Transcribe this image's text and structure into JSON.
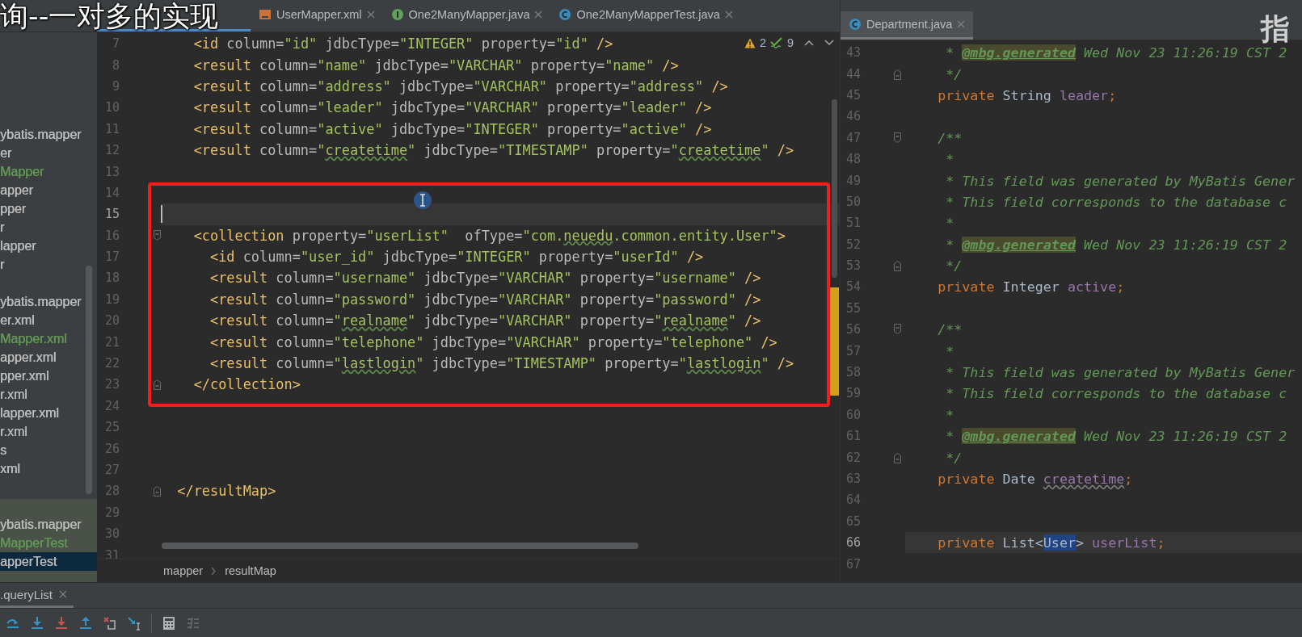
{
  "overlay_caption": "询--一对多的实现",
  "overlay_corner_text": "指",
  "sidebar": {
    "groups": [
      {
        "highlighted": false,
        "items": [
          {
            "label": "ybatis.mapper",
            "color": "#bbbbbb",
            "selected": false
          },
          {
            "label": "er",
            "color": "#bbbbbb",
            "selected": false
          },
          {
            "label": "Mapper",
            "color": "#629755",
            "selected": false
          },
          {
            "label": "apper",
            "color": "#bbbbbb",
            "selected": false
          },
          {
            "label": "pper",
            "color": "#bbbbbb",
            "selected": false
          },
          {
            "label": "r",
            "color": "#bbbbbb",
            "selected": false
          },
          {
            "label": "lapper",
            "color": "#bbbbbb",
            "selected": false
          },
          {
            "label": "r",
            "color": "#bbbbbb",
            "selected": false
          }
        ]
      },
      {
        "highlighted": false,
        "items": [
          {
            "label": "ybatis.mapper",
            "color": "#bbbbbb",
            "selected": false
          },
          {
            "label": "er.xml",
            "color": "#bbbbbb",
            "selected": false
          },
          {
            "label": "Mapper.xml",
            "color": "#629755",
            "selected": false
          },
          {
            "label": "apper.xml",
            "color": "#bbbbbb",
            "selected": false
          },
          {
            "label": "pper.xml",
            "color": "#bbbbbb",
            "selected": false
          },
          {
            "label": "r.xml",
            "color": "#bbbbbb",
            "selected": false
          },
          {
            "label": "lapper.xml",
            "color": "#bbbbbb",
            "selected": false
          },
          {
            "label": "r.xml",
            "color": "#bbbbbb",
            "selected": false
          },
          {
            "label": "s",
            "color": "#bbbbbb",
            "selected": false
          },
          {
            "label": "xml",
            "color": "#bbbbbb",
            "selected": false
          }
        ]
      },
      {
        "highlighted": true,
        "items": [
          {
            "label": "ybatis.mapper",
            "color": "#bbbbbb",
            "selected": false
          },
          {
            "label": "MapperTest",
            "color": "#629755",
            "selected": false
          },
          {
            "label": "apperTest",
            "color": "#bbbbbb",
            "selected": true
          }
        ]
      }
    ]
  },
  "left_editor": {
    "tabs": [
      {
        "kind": "xml",
        "label": "UserMapper.xml",
        "selected": false
      },
      {
        "kind": "interface",
        "label": "One2ManyMapper.java",
        "selected": false
      },
      {
        "kind": "class",
        "label": "One2ManyMapperTest.java",
        "selected": false
      }
    ],
    "inspections": {
      "warnings": "2",
      "weak_warnings": "9"
    },
    "lines": [
      {
        "n": "7",
        "current": false,
        "tokens": [
          {
            "text": "    <id",
            "kind": "tag"
          },
          {
            "text": " column=",
            "kind": "attr"
          },
          {
            "text": "\"id\"",
            "kind": "value"
          },
          {
            "text": " jdbcType=",
            "kind": "attr"
          },
          {
            "text": "\"INTEGER\"",
            "kind": "value"
          },
          {
            "text": " property=",
            "kind": "attr"
          },
          {
            "text": "\"id\"",
            "kind": "value"
          },
          {
            "text": " />",
            "kind": "tag"
          }
        ]
      },
      {
        "n": "8",
        "current": false,
        "tokens": [
          {
            "text": "    <result",
            "kind": "tag"
          },
          {
            "text": " column=",
            "kind": "attr"
          },
          {
            "text": "\"name\"",
            "kind": "value"
          },
          {
            "text": " jdbcType=",
            "kind": "attr"
          },
          {
            "text": "\"VARCHAR\"",
            "kind": "value"
          },
          {
            "text": " property=",
            "kind": "attr"
          },
          {
            "text": "\"name\"",
            "kind": "value"
          },
          {
            "text": " />",
            "kind": "tag"
          }
        ]
      },
      {
        "n": "9",
        "current": false,
        "tokens": [
          {
            "text": "    <result",
            "kind": "tag"
          },
          {
            "text": " column=",
            "kind": "attr"
          },
          {
            "text": "\"address\"",
            "kind": "value"
          },
          {
            "text": " jdbcType=",
            "kind": "attr"
          },
          {
            "text": "\"VARCHAR\"",
            "kind": "value"
          },
          {
            "text": " property=",
            "kind": "attr"
          },
          {
            "text": "\"address\"",
            "kind": "value"
          },
          {
            "text": " />",
            "kind": "tag"
          }
        ]
      },
      {
        "n": "10",
        "current": false,
        "tokens": [
          {
            "text": "    <result",
            "kind": "tag"
          },
          {
            "text": " column=",
            "kind": "attr"
          },
          {
            "text": "\"leader\"",
            "kind": "value"
          },
          {
            "text": " jdbcType=",
            "kind": "attr"
          },
          {
            "text": "\"VARCHAR\"",
            "kind": "value"
          },
          {
            "text": " property=",
            "kind": "attr"
          },
          {
            "text": "\"leader\"",
            "kind": "value"
          },
          {
            "text": " />",
            "kind": "tag"
          }
        ]
      },
      {
        "n": "11",
        "current": false,
        "tokens": [
          {
            "text": "    <result",
            "kind": "tag"
          },
          {
            "text": " column=",
            "kind": "attr"
          },
          {
            "text": "\"active\"",
            "kind": "value"
          },
          {
            "text": " jdbcType=",
            "kind": "attr"
          },
          {
            "text": "\"INTEGER\"",
            "kind": "value"
          },
          {
            "text": " property=",
            "kind": "attr"
          },
          {
            "text": "\"active\"",
            "kind": "value"
          },
          {
            "text": " />",
            "kind": "tag"
          }
        ]
      },
      {
        "n": "12",
        "current": false,
        "tokens": [
          {
            "text": "    <result",
            "kind": "tag"
          },
          {
            "text": " column=",
            "kind": "attr"
          },
          {
            "text": "\"",
            "kind": "value"
          },
          {
            "text": "createtime",
            "kind": "value-typo"
          },
          {
            "text": "\"",
            "kind": "value"
          },
          {
            "text": " jdbcType=",
            "kind": "attr"
          },
          {
            "text": "\"TIMESTAMP\"",
            "kind": "value"
          },
          {
            "text": " property=",
            "kind": "attr"
          },
          {
            "text": "\"",
            "kind": "value"
          },
          {
            "text": "createtime",
            "kind": "value-typo"
          },
          {
            "text": "\"",
            "kind": "value"
          },
          {
            "text": " />",
            "kind": "tag"
          }
        ]
      },
      {
        "n": "13",
        "current": false
      },
      {
        "n": "14",
        "current": false
      },
      {
        "n": "15",
        "current": true,
        "caret": true
      },
      {
        "n": "16",
        "current": false,
        "fold_start": true,
        "tokens": [
          {
            "text": "    <collection",
            "kind": "tag"
          },
          {
            "text": " property=",
            "kind": "attr"
          },
          {
            "text": "\"userList\"",
            "kind": "value"
          },
          {
            "text": "  ofType=",
            "kind": "attr"
          },
          {
            "text": "\"com.",
            "kind": "value"
          },
          {
            "text": "neuedu",
            "kind": "value-typo"
          },
          {
            "text": ".common.entity.User\"",
            "kind": "value"
          },
          {
            "text": ">",
            "kind": "tag"
          }
        ]
      },
      {
        "n": "17",
        "current": false,
        "tokens": [
          {
            "text": "      <id",
            "kind": "tag"
          },
          {
            "text": " column=",
            "kind": "attr"
          },
          {
            "text": "\"user_id\"",
            "kind": "value"
          },
          {
            "text": " jdbcType=",
            "kind": "attr"
          },
          {
            "text": "\"INTEGER\"",
            "kind": "value"
          },
          {
            "text": " property=",
            "kind": "attr"
          },
          {
            "text": "\"userId\"",
            "kind": "value"
          },
          {
            "text": " />",
            "kind": "tag"
          }
        ]
      },
      {
        "n": "18",
        "current": false,
        "tokens": [
          {
            "text": "      <result",
            "kind": "tag"
          },
          {
            "text": " column=",
            "kind": "attr"
          },
          {
            "text": "\"username\"",
            "kind": "value"
          },
          {
            "text": " jdbcType=",
            "kind": "attr"
          },
          {
            "text": "\"VARCHAR\"",
            "kind": "value"
          },
          {
            "text": " property=",
            "kind": "attr"
          },
          {
            "text": "\"username\"",
            "kind": "value"
          },
          {
            "text": " />",
            "kind": "tag"
          }
        ]
      },
      {
        "n": "19",
        "current": false,
        "tokens": [
          {
            "text": "      <result",
            "kind": "tag"
          },
          {
            "text": " column=",
            "kind": "attr"
          },
          {
            "text": "\"password\"",
            "kind": "value"
          },
          {
            "text": " jdbcType=",
            "kind": "attr"
          },
          {
            "text": "\"VARCHAR\"",
            "kind": "value"
          },
          {
            "text": " property=",
            "kind": "attr"
          },
          {
            "text": "\"password\"",
            "kind": "value"
          },
          {
            "text": " />",
            "kind": "tag"
          }
        ]
      },
      {
        "n": "20",
        "current": false,
        "tokens": [
          {
            "text": "      <result",
            "kind": "tag"
          },
          {
            "text": " column=",
            "kind": "attr"
          },
          {
            "text": "\"",
            "kind": "value"
          },
          {
            "text": "realname",
            "kind": "value-typo"
          },
          {
            "text": "\"",
            "kind": "value"
          },
          {
            "text": " jdbcType=",
            "kind": "attr"
          },
          {
            "text": "\"VARCHAR\"",
            "kind": "value"
          },
          {
            "text": " property=",
            "kind": "attr"
          },
          {
            "text": "\"",
            "kind": "value"
          },
          {
            "text": "realname",
            "kind": "value-typo"
          },
          {
            "text": "\"",
            "kind": "value"
          },
          {
            "text": " />",
            "kind": "tag"
          }
        ]
      },
      {
        "n": "21",
        "current": false,
        "tokens": [
          {
            "text": "      <result",
            "kind": "tag"
          },
          {
            "text": " column=",
            "kind": "attr"
          },
          {
            "text": "\"telephone\"",
            "kind": "value"
          },
          {
            "text": " jdbcType=",
            "kind": "attr"
          },
          {
            "text": "\"VARCHAR\"",
            "kind": "value"
          },
          {
            "text": " property=",
            "kind": "attr"
          },
          {
            "text": "\"telephone\"",
            "kind": "value"
          },
          {
            "text": " />",
            "kind": "tag"
          }
        ]
      },
      {
        "n": "22",
        "current": false,
        "tokens": [
          {
            "text": "      <result",
            "kind": "tag"
          },
          {
            "text": " column=",
            "kind": "attr"
          },
          {
            "text": "\"",
            "kind": "value"
          },
          {
            "text": "lastlogin",
            "kind": "value-typo"
          },
          {
            "text": "\"",
            "kind": "value"
          },
          {
            "text": " jdbcType=",
            "kind": "attr"
          },
          {
            "text": "\"TIMESTAMP\"",
            "kind": "value"
          },
          {
            "text": " property=",
            "kind": "attr"
          },
          {
            "text": "\"",
            "kind": "value"
          },
          {
            "text": "lastlogin",
            "kind": "value-typo"
          },
          {
            "text": "\"",
            "kind": "value"
          },
          {
            "text": " />",
            "kind": "tag"
          }
        ]
      },
      {
        "n": "23",
        "current": false,
        "fold_end": true,
        "tokens": [
          {
            "text": "    </collection>",
            "kind": "tag"
          }
        ]
      },
      {
        "n": "24",
        "current": false
      },
      {
        "n": "25",
        "current": false
      },
      {
        "n": "26",
        "current": false
      },
      {
        "n": "27",
        "current": false
      },
      {
        "n": "28",
        "current": false,
        "fold_end": true,
        "tokens": [
          {
            "text": "  </resultMap>",
            "kind": "tag"
          }
        ]
      },
      {
        "n": "29",
        "current": false
      },
      {
        "n": "30",
        "current": false
      },
      {
        "n": "31",
        "current": false
      }
    ],
    "breadcrumbs": [
      "mapper",
      "resultMap"
    ]
  },
  "right_editor": {
    "tabs": [
      {
        "kind": "class",
        "label": "Department.java",
        "selected": true
      }
    ],
    "lines": [
      {
        "n": "43",
        "current": false,
        "tokens": [
          {
            "text": "     * ",
            "kind": "comment"
          },
          {
            "text": "@mbg.generated",
            "kind": "annotation"
          },
          {
            "text": " Wed Nov 23 11:26:19 CST 2",
            "kind": "comment"
          }
        ]
      },
      {
        "n": "44",
        "current": false,
        "fold_end": true,
        "tokens": [
          {
            "text": "     */",
            "kind": "comment"
          }
        ]
      },
      {
        "n": "45",
        "current": false,
        "tokens": [
          {
            "text": "    private",
            "kind": "keyword"
          },
          {
            "text": " String",
            "kind": "type"
          },
          {
            "text": " leader",
            "kind": "field"
          },
          {
            "text": ";",
            "kind": "keyword"
          }
        ]
      },
      {
        "n": "46",
        "current": false
      },
      {
        "n": "47",
        "current": false,
        "fold_start": true,
        "tokens": [
          {
            "text": "    /**",
            "kind": "comment"
          }
        ]
      },
      {
        "n": "48",
        "current": false,
        "tokens": [
          {
            "text": "     *",
            "kind": "comment"
          }
        ]
      },
      {
        "n": "49",
        "current": false,
        "tokens": [
          {
            "text": "     * This field was generated by MyBatis Gener",
            "kind": "comment"
          }
        ]
      },
      {
        "n": "50",
        "current": false,
        "tokens": [
          {
            "text": "     * This field corresponds to the database c",
            "kind": "comment"
          }
        ]
      },
      {
        "n": "51",
        "current": false,
        "tokens": [
          {
            "text": "     *",
            "kind": "comment"
          }
        ]
      },
      {
        "n": "52",
        "current": false,
        "tokens": [
          {
            "text": "     * ",
            "kind": "comment"
          },
          {
            "text": "@mbg.generated",
            "kind": "annotation"
          },
          {
            "text": " Wed Nov 23 11:26:19 CST 2",
            "kind": "comment"
          }
        ]
      },
      {
        "n": "53",
        "current": false,
        "fold_end": true,
        "tokens": [
          {
            "text": "     */",
            "kind": "comment"
          }
        ]
      },
      {
        "n": "54",
        "current": false,
        "tokens": [
          {
            "text": "    private",
            "kind": "keyword"
          },
          {
            "text": " Integer",
            "kind": "type"
          },
          {
            "text": " active",
            "kind": "field"
          },
          {
            "text": ";",
            "kind": "keyword"
          }
        ]
      },
      {
        "n": "55",
        "current": false
      },
      {
        "n": "56",
        "current": false,
        "fold_start": true,
        "tokens": [
          {
            "text": "    /**",
            "kind": "comment"
          }
        ]
      },
      {
        "n": "57",
        "current": false,
        "tokens": [
          {
            "text": "     *",
            "kind": "comment"
          }
        ]
      },
      {
        "n": "58",
        "current": false,
        "tokens": [
          {
            "text": "     * This field was generated by MyBatis Gener",
            "kind": "comment"
          }
        ]
      },
      {
        "n": "59",
        "current": false,
        "tokens": [
          {
            "text": "     * This field corresponds to the database c",
            "kind": "comment"
          }
        ]
      },
      {
        "n": "60",
        "current": false,
        "tokens": [
          {
            "text": "     *",
            "kind": "comment"
          }
        ]
      },
      {
        "n": "61",
        "current": false,
        "tokens": [
          {
            "text": "     * ",
            "kind": "comment"
          },
          {
            "text": "@mbg.generated",
            "kind": "annotation"
          },
          {
            "text": " Wed Nov 23 11:26:19 CST 2",
            "kind": "comment"
          }
        ]
      },
      {
        "n": "62",
        "current": false,
        "fold_end": true,
        "tokens": [
          {
            "text": "     */",
            "kind": "comment"
          }
        ]
      },
      {
        "n": "63",
        "current": false,
        "tokens": [
          {
            "text": "    private",
            "kind": "keyword"
          },
          {
            "text": " Date ",
            "kind": "type"
          },
          {
            "text": "createtime",
            "kind": "field-typo"
          },
          {
            "text": ";",
            "kind": "keyword"
          }
        ]
      },
      {
        "n": "64",
        "current": false
      },
      {
        "n": "65",
        "current": false
      },
      {
        "n": "66",
        "current": true,
        "tokens": [
          {
            "text": "    private",
            "kind": "keyword"
          },
          {
            "text": " List<",
            "kind": "type"
          },
          {
            "text": "User",
            "kind": "selected-text"
          },
          {
            "text": ">",
            "kind": "type"
          },
          {
            "text": " userList",
            "kind": "field"
          },
          {
            "text": ";",
            "kind": "keyword"
          }
        ]
      },
      {
        "n": "67",
        "current": false
      }
    ]
  },
  "tool_window": {
    "tabs": [
      {
        "label": ".queryList",
        "selected": true
      }
    ]
  }
}
